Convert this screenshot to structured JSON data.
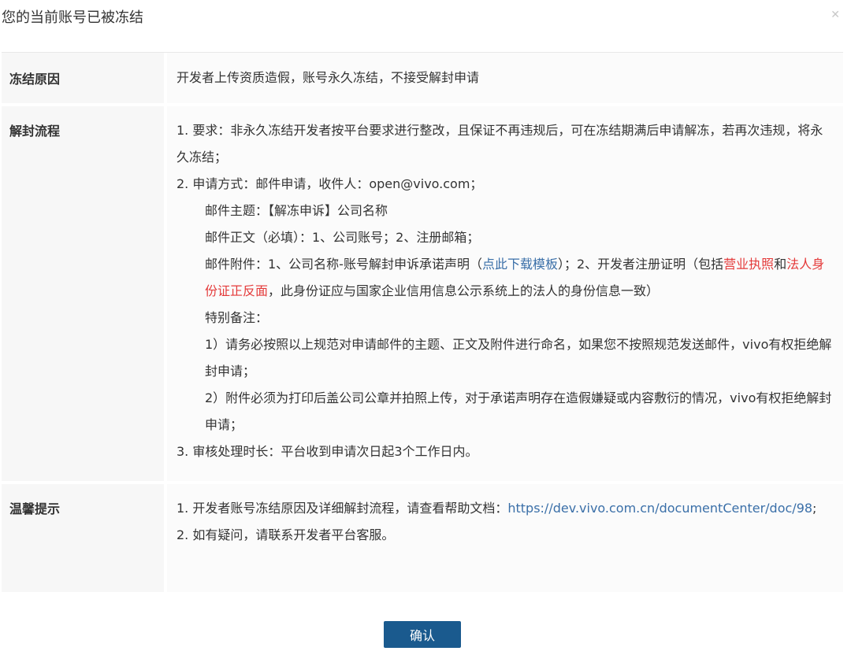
{
  "dialog": {
    "title": "您的当前账号已被冻结",
    "close_icon": "close-icon",
    "confirm_label": "确认"
  },
  "rows": {
    "reason": {
      "label": "冻结原因",
      "text": "开发者上传资质造假，账号永久冻结，不接受解封申请"
    },
    "process": {
      "label": "解封流程",
      "item1": "1. 要求：非永久冻结开发者按平台要求进行整改，且保证不再违规后，可在冻结期满后申请解冻，若再次违规，将永久冻结；",
      "item2": "2. 申请方式：邮件申请，收件人：open@vivo.com；",
      "mail_subject": "邮件主题：【解冻申诉】公司名称",
      "mail_body": "邮件正文（必填）：1、公司账号；2、注册邮箱；",
      "attach_prefix": "邮件附件：1、公司名称-账号解封申诉承诺声明（",
      "attach_link": "点此下载模板",
      "attach_mid": "）；2、开发者注册证明（包括",
      "attach_red1": "营业执照",
      "attach_and": "和",
      "attach_red2": "法人身份证正反面",
      "attach_suffix": "，此身份证应与国家企业信用信息公示系统上的法人的身份信息一致）",
      "special_note": "特别备注：",
      "note1": "1）请务必按照以上规范对申请邮件的主题、正文及附件进行命名，如果您不按照规范发送邮件，vivo有权拒绝解封申请；",
      "note2": "2）附件必须为打印后盖公司公章并拍照上传，对于承诺声明存在造假嫌疑或内容敷衍的情况，vivo有权拒绝解封申请；",
      "item3": "3. 审核处理时长：平台收到申请次日起3个工作日内。"
    },
    "tips": {
      "label": "温馨提示",
      "tip1_prefix": "1. 开发者账号冻结原因及详细解封流程，请查看帮助文档：",
      "tip1_link": "https://dev.vivo.com.cn/documentCenter/doc/98",
      "tip1_suffix": ";",
      "tip2": "2. 如有疑问，请联系开发者平台客服。"
    }
  },
  "colors": {
    "confirm_button": "#1a5a8e",
    "link": "#3a6fa8",
    "highlight_red": "#e43a3a"
  }
}
